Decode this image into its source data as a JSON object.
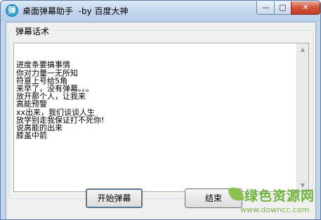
{
  "window": {
    "icon_glyph": "弹",
    "title": "桌面弹幕助手  -by 百度大神",
    "controls": {
      "minimize": "—",
      "maximize": "□",
      "close": "✕"
    }
  },
  "group": {
    "label": "弹幕话术",
    "lines": [
      "进度条要搞事情",
      "你对力量一无所知",
      "符意上号给5角",
      "来早了，没有弹幕。。。",
      "放开那个人，让我来",
      "高能预警",
      "xx出来，我们谈谈人生",
      "放学别走我保证打不死你!",
      "说高能的出来",
      "膝盖中箭"
    ],
    "scrollbar": {
      "up": "▲",
      "down": "▼"
    }
  },
  "buttons": {
    "start": "开始弹幕",
    "end": "结束"
  },
  "watermark": {
    "title": "绿色资源网",
    "url": "www.downcc.com"
  }
}
